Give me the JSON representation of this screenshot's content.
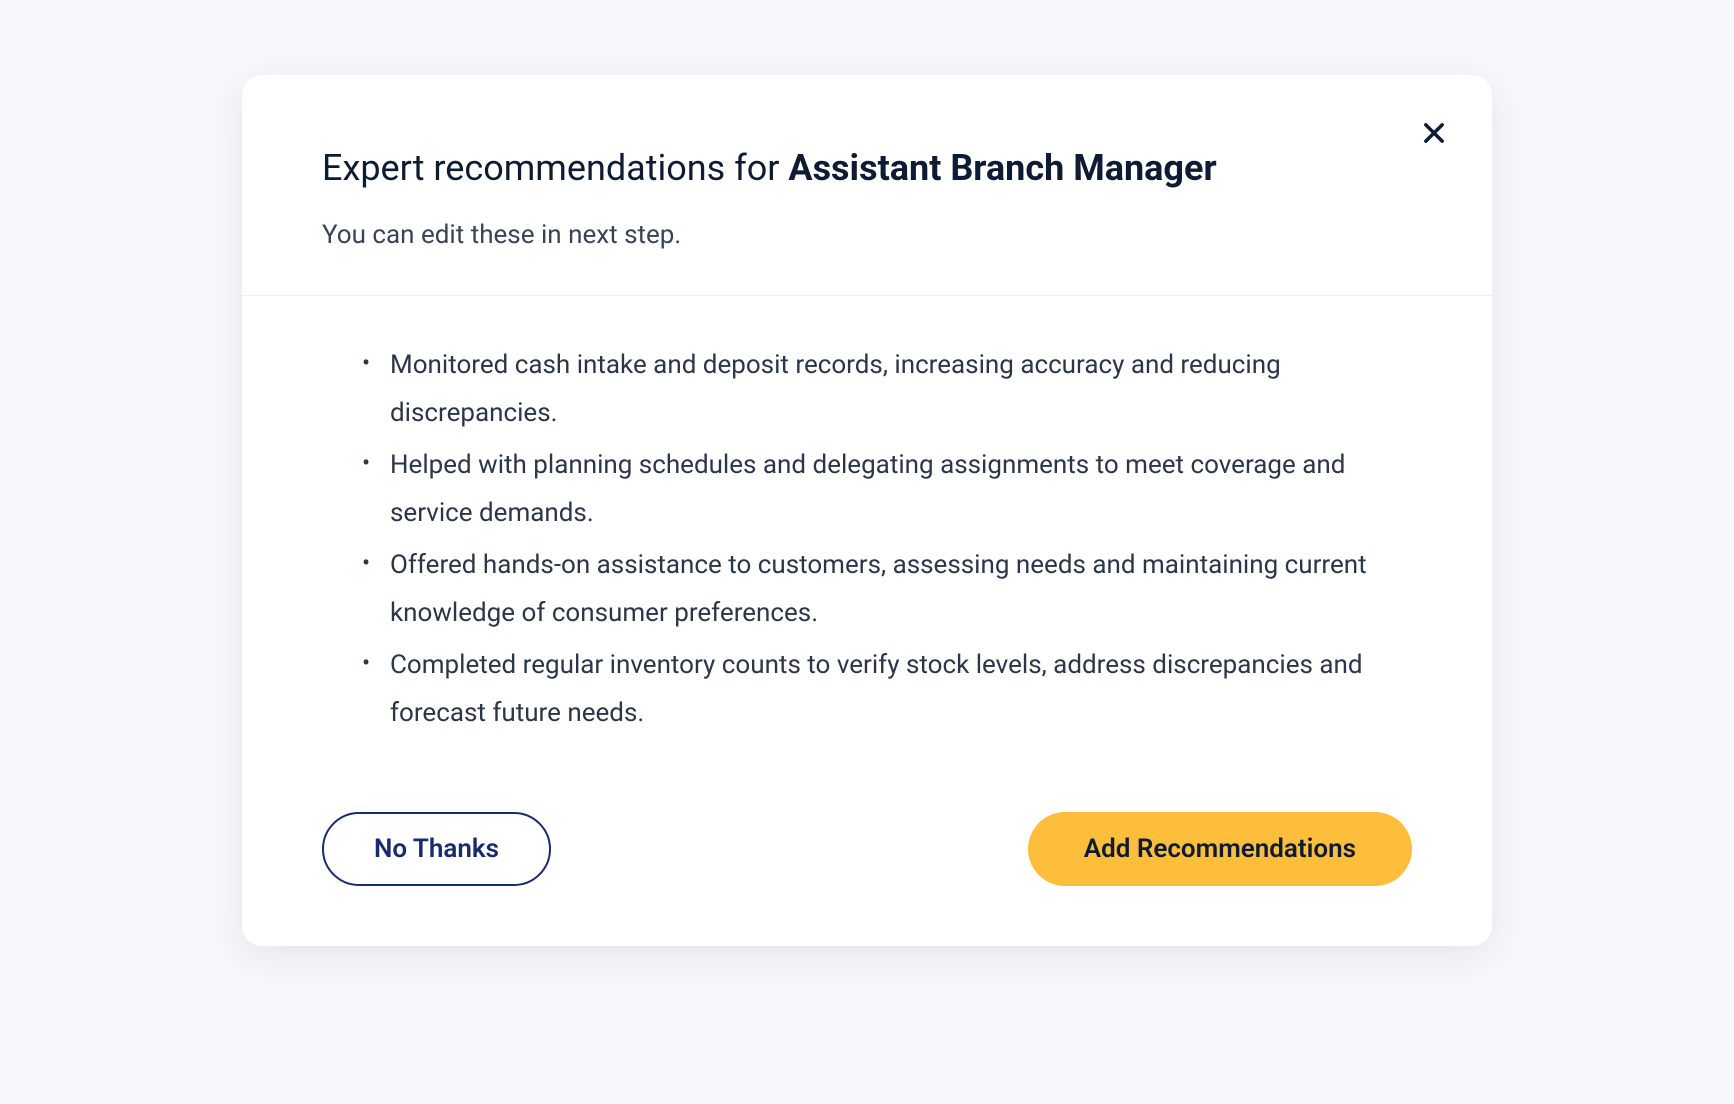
{
  "modal": {
    "title_prefix": "Expert recommendations for ",
    "title_role": "Assistant Branch Manager",
    "subtitle": "You can edit these in next step.",
    "recommendations": [
      "Monitored cash intake and deposit records, increasing accuracy and reducing discrepancies.",
      "Helped with planning schedules and delegating assignments to meet coverage and service demands.",
      "Offered hands-on assistance to customers, assessing needs and maintaining current knowledge of consumer preferences.",
      "Completed regular inventory counts to verify stock levels, address discrepancies and forecast future needs."
    ],
    "buttons": {
      "decline_label": "No Thanks",
      "accept_label": "Add Recommendations"
    }
  }
}
